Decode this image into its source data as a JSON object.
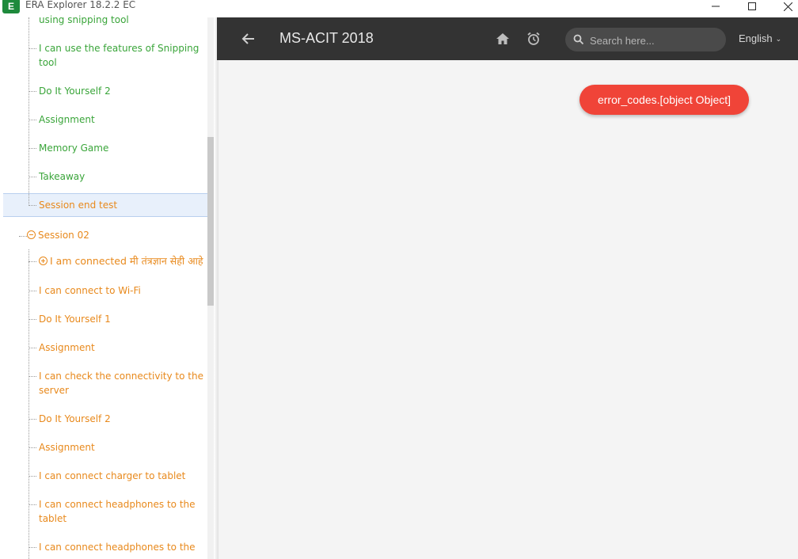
{
  "window": {
    "title": "ERA Explorer 18.2.2 EC",
    "logo_text": "E",
    "minimize_label": "—",
    "maximize_label": "☐",
    "close_label": "✕"
  },
  "header": {
    "title": "MS-ACIT 2018",
    "search_placeholder": "Search here...",
    "language": "English",
    "back_icon": "arrow-left-icon",
    "home_icon": "home-icon",
    "alarm_icon": "alarm-clock-icon"
  },
  "tree": {
    "session01_items": [
      "using snipping tool",
      "I can use the features of Snipping",
      "tool",
      "Do It Yourself 2",
      "Assignment",
      "Memory Game",
      "Takeaway",
      "Session end test"
    ],
    "session02": {
      "label": "Session 02",
      "items": [
        "I am connected मी तंत्रज्ञान सेही आहे",
        "I can connect to Wi-Fi",
        "Do It Yourself 1",
        "Assignment",
        "I can check the connectivity to the",
        "server",
        "Do It Yourself 2",
        "Assignment",
        "I can connect charger to tablet",
        "I can connect headphones to the",
        "tablet",
        "I can connect headphones to the"
      ]
    }
  },
  "toast": {
    "message": "error_codes.[object Object]"
  },
  "colors": {
    "appbar": "#333333",
    "green_text": "#3aa53a",
    "orange_text": "#e8891c",
    "toast": "#f04438"
  }
}
